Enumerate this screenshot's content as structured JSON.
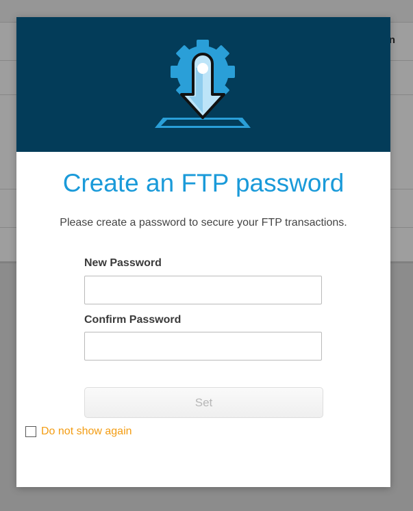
{
  "background": {
    "corner_text": "n"
  },
  "modal": {
    "icon": "gear-download-icon",
    "title": "Create an FTP password",
    "subtitle": "Please create a password to secure your FTP transactions.",
    "new_password_label": "New Password",
    "new_password_value": "",
    "confirm_password_label": "Confirm Password",
    "confirm_password_value": "",
    "set_button_label": "Set",
    "dont_show_label": "Do not show again",
    "dont_show_checked": false
  },
  "colors": {
    "header_bg": "#033c59",
    "title": "#1a9ad9",
    "icon_blue": "#2a9fd8",
    "checkbox_label": "#f39c12"
  }
}
